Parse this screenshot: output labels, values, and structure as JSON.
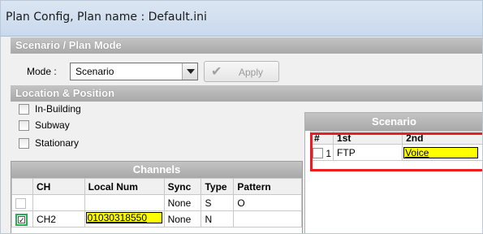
{
  "window": {
    "title": "Plan Config, Plan name : Default.ini"
  },
  "sections": {
    "scenario_plan_mode": "Scenario / Plan Mode",
    "location_position": "Location & Position"
  },
  "mode": {
    "label": "Mode :",
    "selected": "Scenario",
    "apply_label": "Apply"
  },
  "location_options": [
    "In-Building",
    "Subway",
    "Stationary"
  ],
  "channels": {
    "title": "Channels",
    "headers": [
      "",
      "CH",
      "Local Num",
      "Sync",
      "Type",
      "Pattern"
    ],
    "rows": [
      {
        "ch": "",
        "local_num": "",
        "sync": "None",
        "type": "S",
        "pattern": "O"
      },
      {
        "ch": "CH2",
        "local_num": "01030318550",
        "sync": "None",
        "type": "N",
        "pattern": ""
      }
    ]
  },
  "scenario": {
    "title": "Scenario",
    "headers": [
      "#",
      "1st",
      "2nd"
    ],
    "rows": [
      {
        "num": "1",
        "first": "FTP",
        "second": "Voice"
      }
    ]
  }
}
